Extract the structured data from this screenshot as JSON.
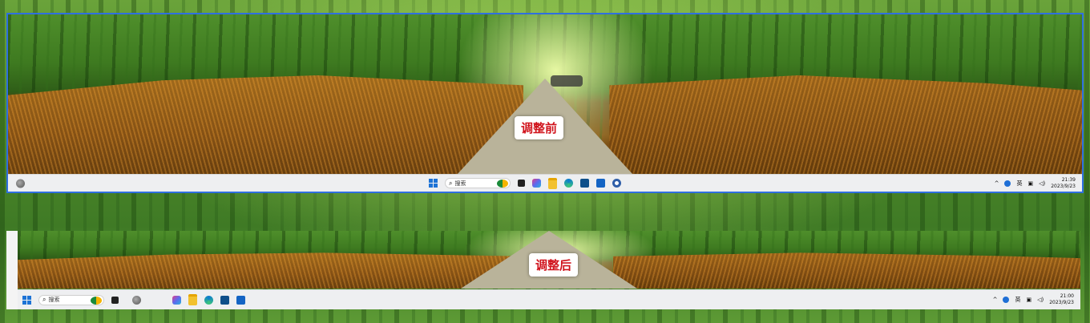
{
  "before": {
    "label": "调整前",
    "search_placeholder": "搜索",
    "tray": {
      "chevron": "^",
      "ime": "英",
      "time": "21:39",
      "date": "2023/9/23"
    },
    "pinned_icons": [
      "start-icon",
      "search-input",
      "task-view-icon",
      "copilot-icon",
      "file-explorer-icon",
      "edge-icon",
      "store-icon",
      "outlook-icon",
      "settings-icon"
    ]
  },
  "after": {
    "label": "调整后",
    "search_placeholder": "搜索",
    "tray": {
      "chevron": "^",
      "ime": "英",
      "time": "21:00",
      "date": "2023/9/23"
    },
    "pinned_icons": [
      "start-icon",
      "search-input",
      "task-view-icon",
      "widget-icon",
      "copilot-icon",
      "file-explorer-icon",
      "edge-icon",
      "store-icon",
      "outlook-icon"
    ]
  },
  "colors": {
    "label_red": "#d0121b",
    "highlight_border": "#2f6fe0",
    "taskbar_bg": "#eeeff1"
  }
}
